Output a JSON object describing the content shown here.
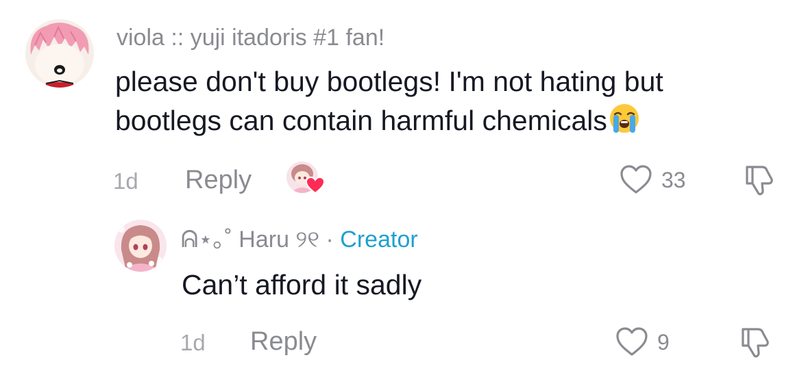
{
  "comment": {
    "username": "viola :: yuji itadoris #1 fan!",
    "text": "please don't buy bootlegs! I'm not hating but bootlegs can contain harmful chemicals",
    "emoji": "loudly-crying-face",
    "time": "1d",
    "reply_label": "Reply",
    "like_count": "33",
    "creator_liked": true,
    "avatar": "pink-haired-character-avatar"
  },
  "reply": {
    "username_prefix": "ᕱ⋆｡˚ Haru ୨୧",
    "separator": " · ",
    "badge": "Creator",
    "text": "Can’t afford it sadly",
    "time": "1d",
    "reply_label": "Reply",
    "like_count": "9",
    "avatar": "anime-girl-avatar"
  },
  "colors": {
    "username": "#8a8b91",
    "body_text": "#161823",
    "creator_badge": "#1fa0cf",
    "liked_heart": "#fe2c55",
    "time": "#a8a8ad"
  }
}
